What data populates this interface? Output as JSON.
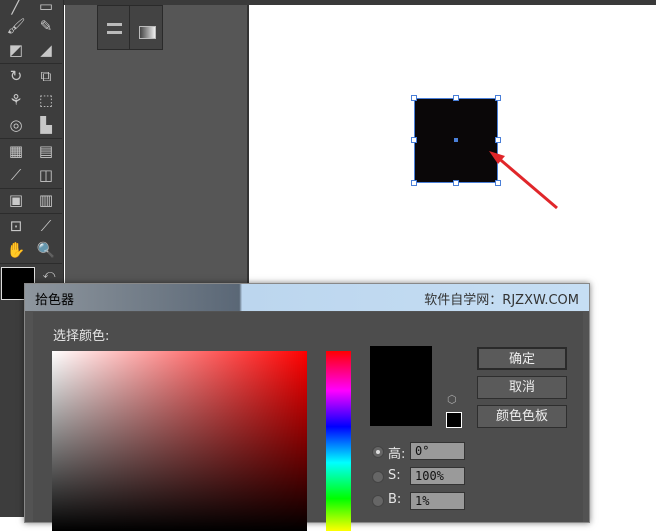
{
  "dialog": {
    "title": "拾色器",
    "watermark": "软件自学网：RJZXW.COM",
    "select_color_label": "选择颜色:",
    "buttons": {
      "ok": "确定",
      "cancel": "取消",
      "swatches": "颜色色板"
    },
    "fields": [
      {
        "label": "高:",
        "value": "0°",
        "selected": true
      },
      {
        "label": "S:",
        "value": "100%",
        "selected": false
      },
      {
        "label": "B:",
        "value": "1%",
        "selected": false
      }
    ],
    "new_color": "#000000"
  },
  "artboard": {
    "shape_fill": "#0a0708",
    "arrow_color": "#e0262a"
  },
  "tools": [
    "pen",
    "rectangle",
    "paintbrush",
    "pencil",
    "shaper",
    "eraser",
    "rotate",
    "scale",
    "puppet-warp",
    "free-transform",
    "shape-builder",
    "perspective-grid",
    "mesh",
    "gradient",
    "eyedropper",
    "blend",
    "symbol-sprayer",
    "column-graph",
    "artboard",
    "slice",
    "hand",
    "zoom"
  ]
}
